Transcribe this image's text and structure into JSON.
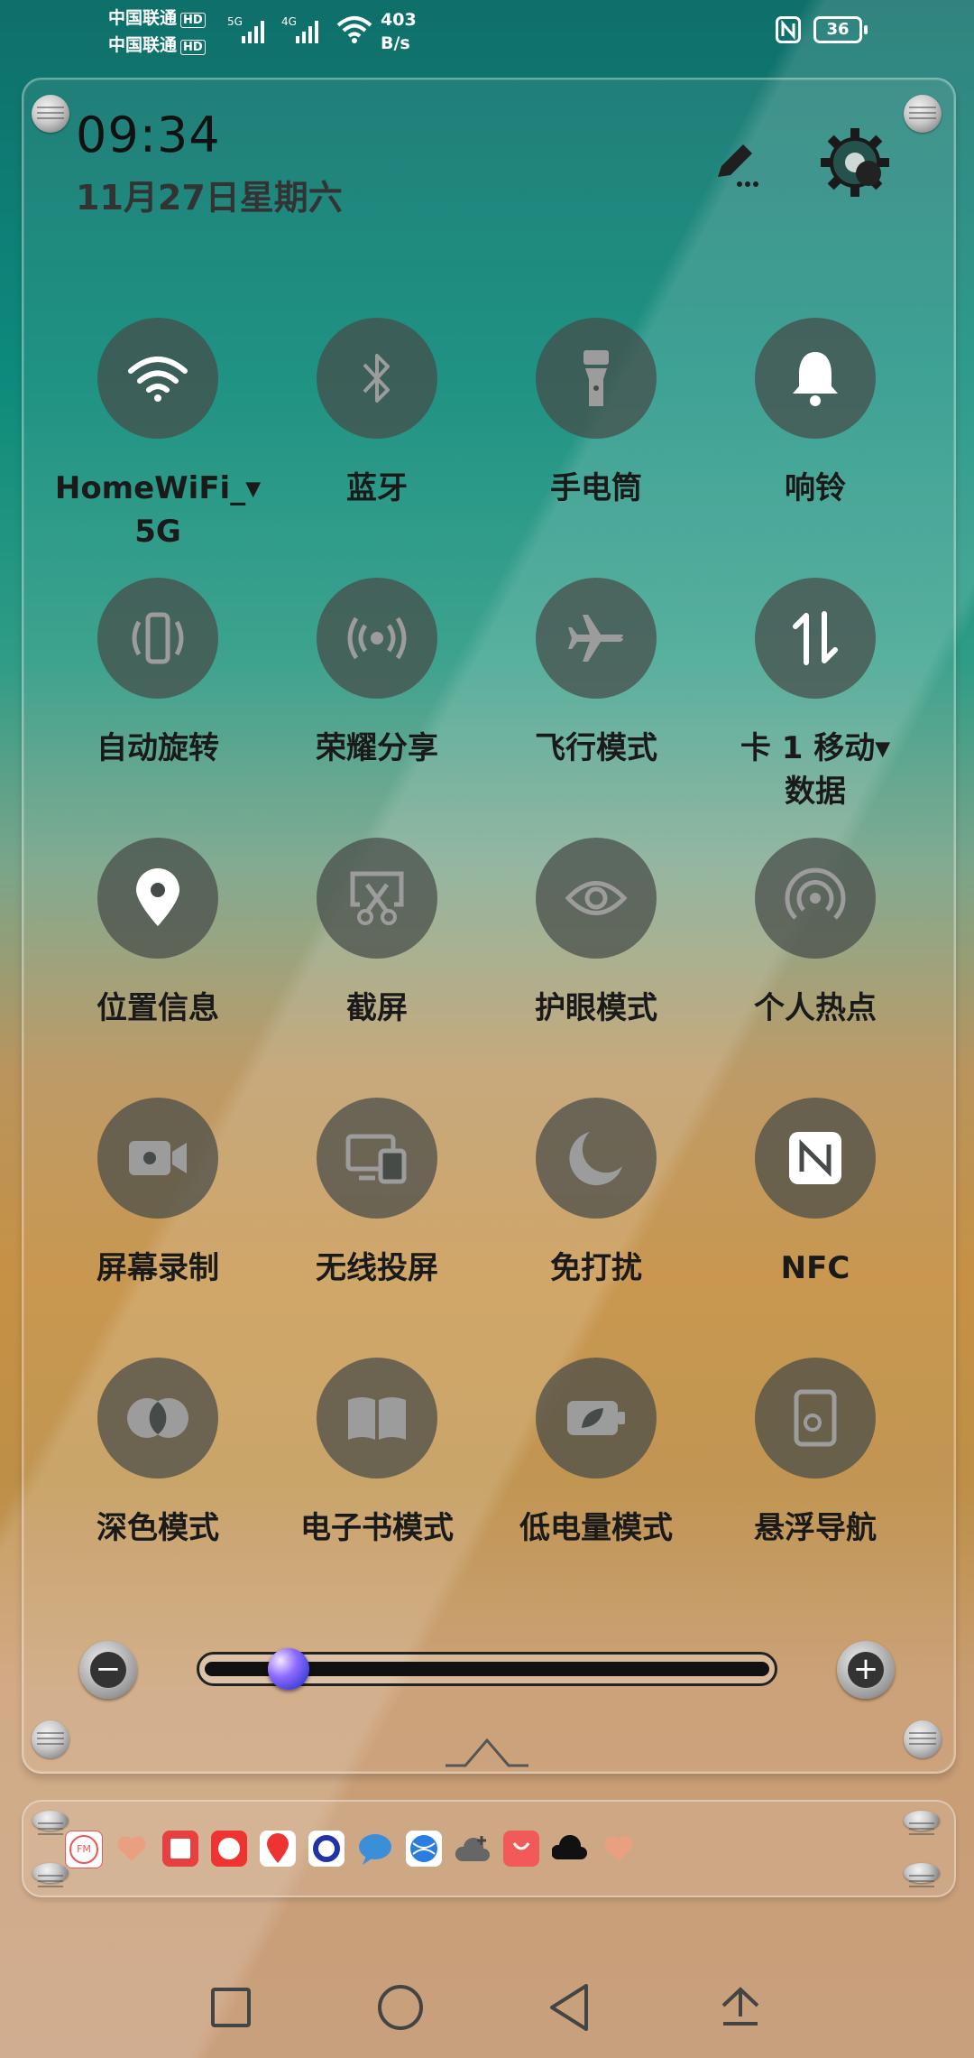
{
  "status_bar": {
    "carrier1": "中国联通",
    "carrier2": "中国联通",
    "hd_badge": "HD",
    "net_5g": "5G",
    "net_4g": "4G",
    "speed_value": "403",
    "speed_unit": "B/s",
    "battery": "36"
  },
  "header": {
    "time": "09:34",
    "date": "11月27日星期六"
  },
  "tiles": [
    {
      "label": "HomeWiFi_",
      "label2": "5G",
      "icon": "wifi-icon",
      "active": true
    },
    {
      "label": "蓝牙",
      "icon": "bluetooth-icon"
    },
    {
      "label": "手电筒",
      "icon": "flashlight-icon"
    },
    {
      "label": "响铃",
      "icon": "bell-icon",
      "active": true
    },
    {
      "label": "自动旋转",
      "icon": "auto-rotate-icon"
    },
    {
      "label": "荣耀分享",
      "icon": "share-icon"
    },
    {
      "label": "飞行模式",
      "icon": "airplane-icon"
    },
    {
      "label": "卡 1 移动",
      "label2": "数据",
      "icon": "mobile-data-icon",
      "active": true
    },
    {
      "label": "位置信息",
      "icon": "location-icon",
      "active": true
    },
    {
      "label": "截屏",
      "icon": "screenshot-icon"
    },
    {
      "label": "护眼模式",
      "icon": "eye-icon"
    },
    {
      "label": "个人热点",
      "icon": "hotspot-icon"
    },
    {
      "label": "屏幕录制",
      "icon": "screen-record-icon"
    },
    {
      "label": "无线投屏",
      "icon": "cast-icon"
    },
    {
      "label": "免打扰",
      "icon": "moon-icon"
    },
    {
      "label": "NFC",
      "icon": "nfc-icon",
      "active": true
    },
    {
      "label": "深色模式",
      "icon": "dark-mode-icon"
    },
    {
      "label": "电子书模式",
      "icon": "ebook-icon"
    },
    {
      "label": "低电量模式",
      "icon": "battery-saver-icon"
    },
    {
      "label": "悬浮导航",
      "icon": "floating-nav-icon"
    }
  ],
  "brightness": {
    "minus": "−",
    "plus": "+",
    "level": 0.14
  },
  "dock_apps": [
    "fm-icon",
    "heart-icon",
    "book-app-icon",
    "jd-icon",
    "map-pin-app-icon",
    "circle-app-icon",
    "chat-bubble-icon",
    "browser-icon",
    "cloud-add-icon",
    "store-icon",
    "cloud-icon",
    "heart-icon"
  ],
  "colors": {
    "tile_bg": "#464b48",
    "text": "#1a1a1a"
  }
}
